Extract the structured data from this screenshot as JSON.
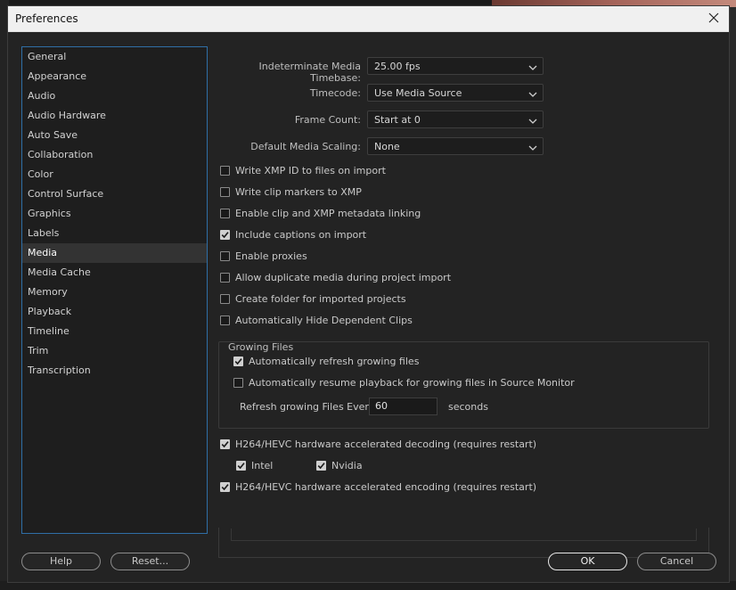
{
  "window": {
    "title": "Preferences"
  },
  "categories": [
    "General",
    "Appearance",
    "Audio",
    "Audio Hardware",
    "Auto Save",
    "Collaboration",
    "Color",
    "Control Surface",
    "Graphics",
    "Labels",
    "Media",
    "Media Cache",
    "Memory",
    "Playback",
    "Timeline",
    "Trim",
    "Transcription"
  ],
  "selected_category": "Media",
  "dropdowns": {
    "timebase": {
      "label": "Indeterminate Media Timebase:",
      "value": "25.00 fps"
    },
    "timecode": {
      "label": "Timecode:",
      "value": "Use Media Source"
    },
    "frame_count": {
      "label": "Frame Count:",
      "value": "Start at 0"
    },
    "scaling": {
      "label": "Default Media Scaling:",
      "value": "None"
    }
  },
  "checkboxes": {
    "write_xmp": {
      "label": "Write XMP ID to files on import",
      "checked": false
    },
    "clip_markers": {
      "label": "Write clip markers to XMP",
      "checked": false
    },
    "metadata_linking": {
      "label": "Enable clip and XMP metadata linking",
      "checked": false
    },
    "captions": {
      "label": "Include captions on import",
      "checked": true
    },
    "proxies": {
      "label": "Enable proxies",
      "checked": false
    },
    "duplicate_media": {
      "label": "Allow duplicate media during project import",
      "checked": false
    },
    "create_folder": {
      "label": "Create folder for imported projects",
      "checked": false
    },
    "hide_dependent": {
      "label": "Automatically Hide Dependent Clips",
      "checked": false
    },
    "hw_decoding": {
      "label": "H264/HEVC hardware accelerated decoding (requires restart)",
      "checked": true
    },
    "intel": {
      "label": "Intel",
      "checked": true
    },
    "nvidia": {
      "label": "Nvidia",
      "checked": true
    },
    "hw_encoding": {
      "label": "H264/HEVC hardware accelerated encoding (requires restart)",
      "checked": true
    }
  },
  "growing_files": {
    "title": "Growing Files",
    "auto_refresh": {
      "label": "Automatically refresh growing files",
      "checked": true
    },
    "auto_resume": {
      "label": "Automatically resume playback for growing files in Source Monitor",
      "checked": false
    },
    "refresh_label": "Refresh growing Files Every",
    "refresh_value": "60",
    "refresh_unit": "seconds"
  },
  "buttons": {
    "help": "Help",
    "reset": "Reset...",
    "ok": "OK",
    "cancel": "Cancel"
  }
}
